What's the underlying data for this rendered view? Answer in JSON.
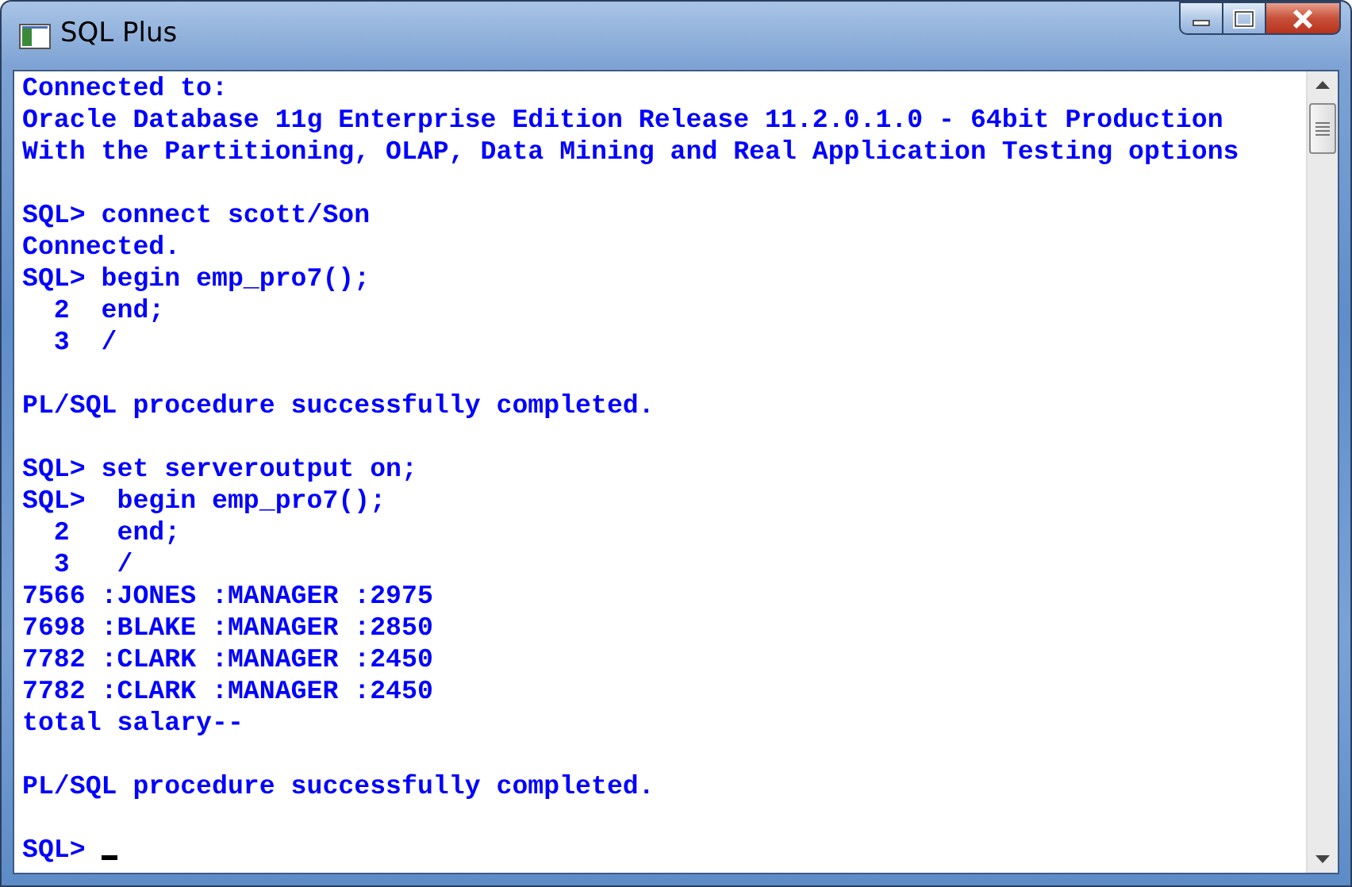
{
  "window": {
    "title": "SQL Plus"
  },
  "console": {
    "blocks": [
      [
        "Connected to:",
        "Oracle Database 11g Enterprise Edition Release 11.2.0.1.0 - 64bit Production",
        "With the Partitioning, OLAP, Data Mining and Real Application Testing options"
      ],
      [
        "SQL> connect scott/Son",
        "Connected.",
        "SQL> begin emp_pro7();",
        "  2  end;",
        "  3  /"
      ],
      [
        "PL/SQL procedure successfully completed."
      ],
      [
        "SQL> set serveroutput on;",
        "SQL>  begin emp_pro7();",
        "  2   end;",
        "  3   /",
        "7566 :JONES :MANAGER :2975",
        "7698 :BLAKE :MANAGER :2850",
        "7782 :CLARK :MANAGER :2450",
        "7782 :CLARK :MANAGER :2450",
        "total salary--"
      ],
      [
        "PL/SQL procedure successfully completed."
      ],
      [
        "SQL> "
      ]
    ]
  }
}
